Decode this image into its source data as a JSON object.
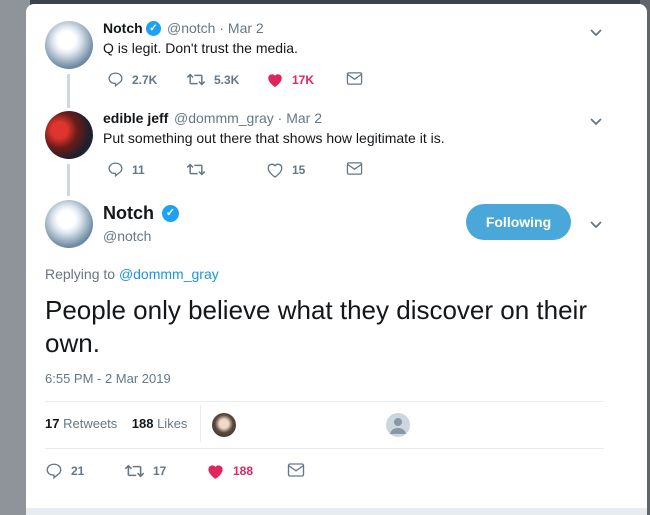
{
  "tweets": [
    {
      "name": "Notch",
      "handle_date": "@notch · Mar 2",
      "text": "Q is legit. Don't trust the media.",
      "replies": "2.7K",
      "retweets": "5.3K",
      "likes": "17K"
    },
    {
      "name": "edible jeff",
      "handle_date": "@dommm_gray · Mar 2",
      "text": "Put something out there that shows how legitimate it is.",
      "replies": "11",
      "retweets": "",
      "likes": "15"
    }
  ],
  "main_tweet": {
    "name": "Notch",
    "handle": "@notch",
    "follow_label": "Following",
    "replying_prefix": "Replying to",
    "replying_to": "@dommm_gray",
    "text": "People only believe what they discover on their own.",
    "timestamp": "6:55 PM - 2 Mar 2019",
    "retweets_count": "17",
    "retweets_label": "Retweets",
    "likes_count": "188",
    "likes_label": "Likes",
    "replies": "21",
    "retweets": "17",
    "likes": "188"
  },
  "colors": {
    "accent": "#1da1f2",
    "like": "#e0245e",
    "follow_button": "#4aa7d9"
  },
  "icons": [
    "reply-icon",
    "retweet-icon",
    "heart-icon",
    "message-icon",
    "verified-icon",
    "chevron-down-icon"
  ]
}
